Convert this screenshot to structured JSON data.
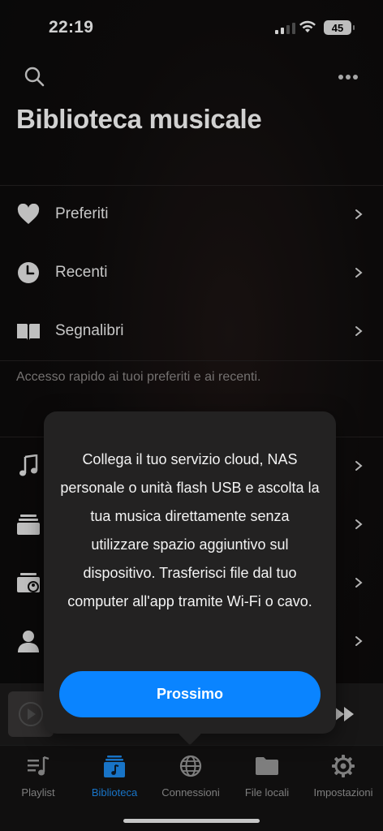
{
  "status_bar": {
    "time": "22:19",
    "battery": "45"
  },
  "header": {
    "title": "Biblioteca musicale"
  },
  "quick_access": {
    "items": [
      {
        "label": "Preferiti",
        "icon": "heart-icon"
      },
      {
        "label": "Recenti",
        "icon": "clock-icon"
      },
      {
        "label": "Segnalibri",
        "icon": "book-icon"
      }
    ],
    "hint": "Accesso rapido ai tuoi preferiti e ai recenti."
  },
  "library_rows": [
    {
      "icon": "music-note-icon"
    },
    {
      "icon": "album-stack-icon"
    },
    {
      "icon": "artist-folder-icon"
    },
    {
      "icon": "person-icon"
    }
  ],
  "popover": {
    "text": "Collega il tuo servizio cloud, NAS personale o unità flash USB e ascolta la tua musica direttamente senza utilizzare spazio aggiuntivo sul dispositivo. Trasferisci file dal tuo computer all'app tramite Wi-Fi o cavo.",
    "button_label": "Prossimo"
  },
  "tabs": [
    {
      "label": "Playlist",
      "icon": "playlist-icon",
      "active": false
    },
    {
      "label": "Biblioteca",
      "icon": "library-icon",
      "active": true
    },
    {
      "label": "Connessioni",
      "icon": "globe-icon",
      "active": false
    },
    {
      "label": "File locali",
      "icon": "folder-icon",
      "active": false
    },
    {
      "label": "Impostazioni",
      "icon": "gear-icon",
      "active": false
    }
  ],
  "colors": {
    "accent": "#0a84ff",
    "active_tab": "#1e8ef3",
    "popover_bg": "#232222"
  }
}
